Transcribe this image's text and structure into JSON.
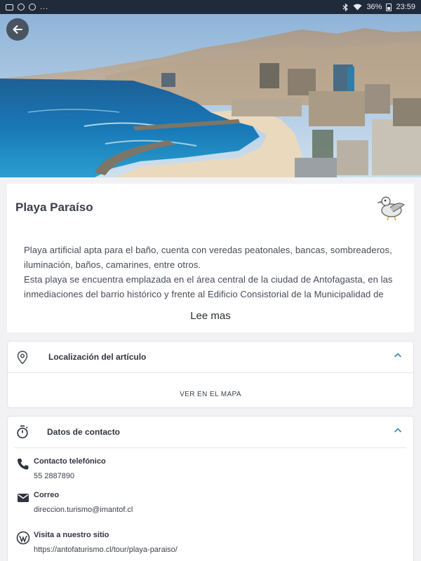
{
  "status_bar": {
    "left_dots": "...",
    "battery": "36%",
    "time": "23:59"
  },
  "colors": {
    "accent": "#3a8dbd",
    "status_bar": "#1f2a3a",
    "background": "#f2f2f4"
  },
  "icons": {
    "back": "arrow-left-icon",
    "location": "map-pin-icon",
    "timer": "stopwatch-icon",
    "phone": "phone-icon",
    "email": "envelope-icon",
    "website": "wordpress-icon",
    "collapse": "chevron-up-icon"
  },
  "place": {
    "title": "Playa Paraíso",
    "description_1": "Playa artificial apta para el baño, cuenta con veredas peatonales, bancas, sombreaderos, iluminación, baños, camarines, entre otros.",
    "description_2": "Esta playa se encuentra emplazada en el área central de la ciudad de Antofagasta, en las inmediaciones del barrio histórico y frente al Edificio Consistorial de la Municipalidad de",
    "read_more": "Lee mas"
  },
  "location": {
    "header": "Localización del artículo",
    "map_link": "VER EN EL MAPA"
  },
  "contact": {
    "header": "Datos de contacto",
    "phone_label": "Contacto telefónico",
    "phone_value": "55 2887890",
    "email_label": "Correo",
    "email_value": "direccion.turismo@imantof.cl",
    "website_label": "Visita a nuestro sitio",
    "website_value": "https://antofaturismo.cl/tour/playa-paraiso/"
  }
}
